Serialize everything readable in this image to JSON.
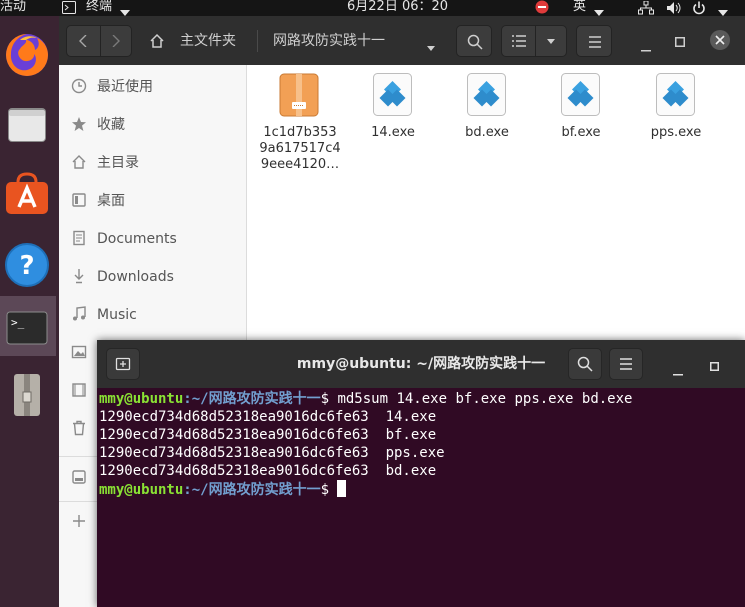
{
  "topbar": {
    "activities": "活动",
    "app_menu": "终端",
    "clock": "6月22日  06：20",
    "input_method": "英"
  },
  "files": {
    "breadcrumb": {
      "home": "主文件夹",
      "current": "网路攻防实践十一"
    },
    "sidebar": [
      {
        "label": "最近使用",
        "icon": "clock-icon"
      },
      {
        "label": "收藏",
        "icon": "star-icon"
      },
      {
        "label": "主目录",
        "icon": "home-icon"
      },
      {
        "label": "桌面",
        "icon": "desktop-icon"
      },
      {
        "label": "Documents",
        "icon": "document-icon"
      },
      {
        "label": "Downloads",
        "icon": "download-icon"
      },
      {
        "label": "Music",
        "icon": "music-icon"
      }
    ],
    "items": [
      {
        "name_lines": [
          "1c1d7b353",
          "9a617517c4",
          "9eee4120…"
        ],
        "icon": "archive-icon"
      },
      {
        "name_lines": [
          "14.exe"
        ],
        "icon": "exe-icon"
      },
      {
        "name_lines": [
          "bd.exe"
        ],
        "icon": "exe-icon"
      },
      {
        "name_lines": [
          "bf.exe"
        ],
        "icon": "exe-icon"
      },
      {
        "name_lines": [
          "pps.exe"
        ],
        "icon": "exe-icon"
      }
    ]
  },
  "terminal": {
    "title": "mmy@ubuntu: ~/网路攻防实践十一",
    "prompt_user": "mmy@ubuntu",
    "prompt_path": ":~/网路攻防实践十一",
    "prompt_symbol": "$ ",
    "command": "md5sum 14.exe bf.exe pps.exe bd.exe",
    "output": [
      "1290ecd734d68d52318ea9016dc6fe63  14.exe",
      "1290ecd734d68d52318ea9016dc6fe63  bf.exe",
      "1290ecd734d68d52318ea9016dc6fe63  pps.exe",
      "1290ecd734d68d52318ea9016dc6fe63  bd.exe"
    ]
  },
  "colors": {
    "terminal_bg": "#300a24",
    "prompt_user": "#8ae234",
    "prompt_path": "#729fcf",
    "ubuntu_orange": "#e95420"
  }
}
